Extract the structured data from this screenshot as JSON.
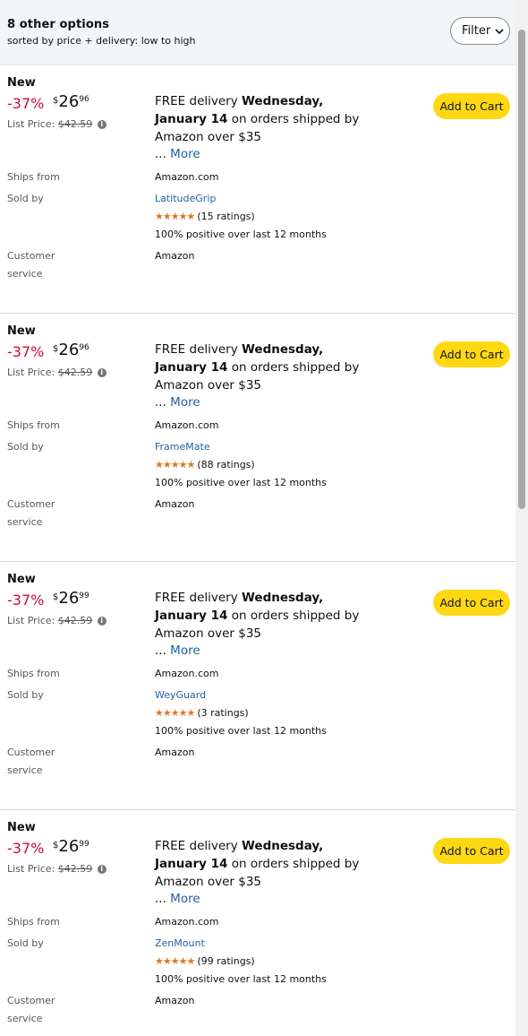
{
  "header": {
    "title": "8 other options",
    "subtitle": "sorted by price + delivery: low to high",
    "filter_label": "Filter"
  },
  "offers": [
    {
      "condition": "New",
      "discount": "-37%",
      "price_symbol": "$",
      "price_whole": "26",
      "price_fraction": "96",
      "list_price_label": "List Price:",
      "list_price": "$42.59",
      "delivery_prefix": "FREE delivery ",
      "delivery_date": "Wednesday, January 14",
      "delivery_suffix": " on orders shipped by Amazon over $35",
      "more_prefix": "... ",
      "more_link": "More",
      "add_to_cart": "Add to Cart",
      "ships_from_label": "Ships from",
      "ships_from": "Amazon.com",
      "sold_by_label": "Sold by",
      "seller": "LatitudeGrip",
      "stars": "★★★★★",
      "ratings": "(15 ratings)",
      "positive": "100% positive over last 12 months",
      "customer_service_label_1": "Customer",
      "customer_service_label_2": "service",
      "customer_service": "Amazon"
    },
    {
      "condition": "New",
      "discount": "-37%",
      "price_symbol": "$",
      "price_whole": "26",
      "price_fraction": "96",
      "list_price_label": "List Price:",
      "list_price": "$42.59",
      "delivery_prefix": "FREE delivery ",
      "delivery_date": "Wednesday, January 14",
      "delivery_suffix": " on orders shipped by Amazon over $35",
      "more_prefix": "... ",
      "more_link": "More",
      "add_to_cart": "Add to Cart",
      "ships_from_label": "Ships from",
      "ships_from": "Amazon.com",
      "sold_by_label": "Sold by",
      "seller": "FrameMate",
      "stars": "★★★★★",
      "ratings": "(88 ratings)",
      "positive": "100% positive over last 12 months",
      "customer_service_label_1": "Customer",
      "customer_service_label_2": "service",
      "customer_service": "Amazon"
    },
    {
      "condition": "New",
      "discount": "-37%",
      "price_symbol": "$",
      "price_whole": "26",
      "price_fraction": "99",
      "list_price_label": "List Price:",
      "list_price": "$42.59",
      "delivery_prefix": "FREE delivery ",
      "delivery_date": "Wednesday, January 14",
      "delivery_suffix": " on orders shipped by Amazon over $35",
      "more_prefix": "... ",
      "more_link": "More",
      "add_to_cart": "Add to Cart",
      "ships_from_label": "Ships from",
      "ships_from": "Amazon.com",
      "sold_by_label": "Sold by",
      "seller": "WeyGuard",
      "stars": "★★★★★",
      "ratings": "(3 ratings)",
      "positive": "100% positive over last 12 months",
      "customer_service_label_1": "Customer",
      "customer_service_label_2": "service",
      "customer_service": "Amazon"
    },
    {
      "condition": "New",
      "discount": "-37%",
      "price_symbol": "$",
      "price_whole": "26",
      "price_fraction": "99",
      "list_price_label": "List Price:",
      "list_price": "$42.59",
      "delivery_prefix": "FREE delivery ",
      "delivery_date": "Wednesday, January 14",
      "delivery_suffix": " on orders shipped by Amazon over $35",
      "more_prefix": "... ",
      "more_link": "More",
      "add_to_cart": "Add to Cart",
      "ships_from_label": "Ships from",
      "ships_from": "Amazon.com",
      "sold_by_label": "Sold by",
      "seller": "ZenMount",
      "stars": "★★★★★",
      "ratings": "(99 ratings)",
      "positive": "100% positive over last 12 months",
      "customer_service_label_1": "Customer",
      "customer_service_label_2": "service",
      "customer_service": "Amazon"
    }
  ],
  "colors": {
    "discount": "#cc0c39",
    "link": "#2162a1",
    "cart_button": "#ffd814",
    "stars": "#de7921"
  }
}
